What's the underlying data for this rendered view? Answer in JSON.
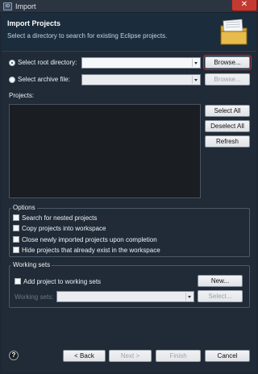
{
  "window": {
    "title": "Import",
    "app_icon": "eclipse-app-icon",
    "close_symbol": "✕"
  },
  "header": {
    "title": "Import Projects",
    "description": "Select a directory to search for existing Eclipse projects."
  },
  "source": {
    "root_label": "Select root directory:",
    "root_value": "",
    "root_browse": "Browse...",
    "archive_label": "Select archive file:",
    "archive_value": "",
    "archive_browse": "Browse..."
  },
  "projects": {
    "label": "Projects:",
    "select_all": "Select All",
    "deselect_all": "Deselect All",
    "refresh": "Refresh"
  },
  "options": {
    "title": "Options",
    "items": [
      {
        "label": "Search for nested projects",
        "checked": false
      },
      {
        "label": "Copy projects into workspace",
        "checked": false
      },
      {
        "label": "Close newly imported projects upon completion",
        "checked": false
      },
      {
        "label": "Hide projects that already exist in the workspace",
        "checked": false
      }
    ]
  },
  "working_sets": {
    "title": "Working sets",
    "add_label": "Add project to working sets",
    "new_button": "New...",
    "sets_label": "Working sets:",
    "sets_value": "",
    "select_button": "Select..."
  },
  "footer": {
    "help": "?",
    "back": "< Back",
    "next": "Next >",
    "finish": "Finish",
    "cancel": "Cancel"
  },
  "colors": {
    "highlight": "#d9262a",
    "close": "#c33a33"
  }
}
